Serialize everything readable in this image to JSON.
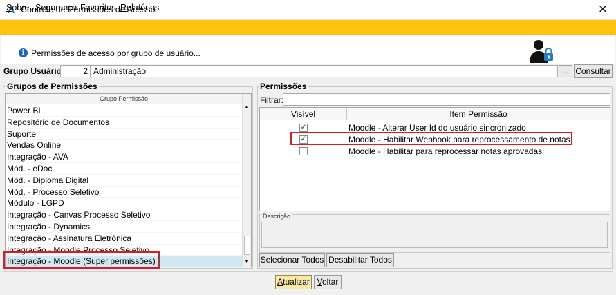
{
  "window": {
    "title": "Controle de Permissões de Acesso",
    "close_glyph": "✕",
    "app_icon": "app-logo-icon"
  },
  "menu": [
    {
      "accel": "S",
      "rest": "obre"
    },
    {
      "accel": "",
      "rest": "Segurança"
    },
    {
      "accel": "",
      "rest": "Favoritos"
    },
    {
      "accel": "R",
      "rest": "elatórios"
    }
  ],
  "header": {
    "info_icon_glyph": "i",
    "info_text": "Permissões de acesso por grupo de usuário...",
    "user_lock_icon": "user-lock-icon"
  },
  "group_user": {
    "label": "Grupo Usuário:",
    "code": "2",
    "name": "Administração",
    "lookup_label": "...",
    "consult_label": "Consultar"
  },
  "groups_panel": {
    "title": "Grupos de Permissões",
    "column_header": "Grupo Permissão",
    "items": [
      "Power BI",
      "Repositório de Documentos",
      "Suporte",
      "Vendas Online",
      "Integração - AVA",
      "Mód. - eDoc",
      "Mód. - Diploma Digital",
      "Mód. - Processo Seletivo",
      "Módulo - LGPD",
      "Integração - Canvas Processo Seletivo",
      "Integração - Dynamics",
      "Integração - Assinatura Eletrônica",
      "Integração - Moodle Processo Seletivo",
      "Integração - Moodle (Super permissões)"
    ],
    "selected_index": 13,
    "scroll_up": "▲",
    "scroll_down": "▼"
  },
  "permissions_panel": {
    "title": "Permissões",
    "filter_label": "Filtrar:",
    "filter_value": "",
    "col_visible": "Visível",
    "col_item": "Item Permissão",
    "rows": [
      {
        "checked": true,
        "check_glyph": "✓",
        "label": "Moodle - Alterar User Id do usuário sincronizado"
      },
      {
        "checked": true,
        "check_glyph": "✓",
        "label": "Moodle - Habilitar Webhook para reprocessamento de notas"
      },
      {
        "checked": false,
        "check_glyph": "",
        "label": "Moodle - Habilitar para reprocessar notas aprovadas"
      }
    ],
    "description_label": "Descrição",
    "select_all_label": "Selecionar Todos",
    "disable_all_label": "Desabilitar Todos"
  },
  "footer": {
    "update_accel": "A",
    "update_rest": "tualizar",
    "back_accel": "V",
    "back_rest": "oltar"
  },
  "colors": {
    "menu_bar": "#ffc20e",
    "selection": "#cfe8f2",
    "highlight": "#e0191e",
    "check": "#2e8b2e"
  }
}
